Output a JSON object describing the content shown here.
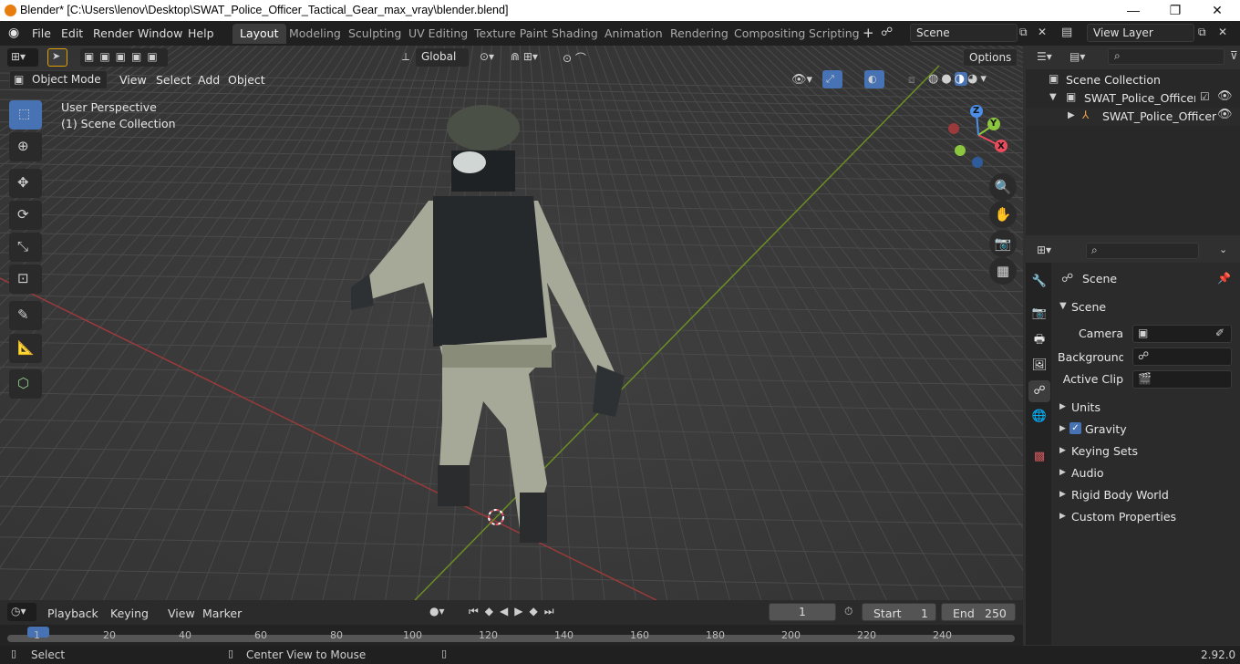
{
  "window": {
    "title": "Blender* [C:\\Users\\lenov\\Desktop\\SWAT_Police_Officer_Tactical_Gear_max_vray\\blender.blend]",
    "minimize": "—",
    "maximize": "❐",
    "close": "✕"
  },
  "menus": [
    "File",
    "Edit",
    "Render",
    "Window",
    "Help"
  ],
  "workspaces": [
    "Layout",
    "Modeling",
    "Sculpting",
    "UV Editing",
    "Texture Paint",
    "Shading",
    "Animation",
    "Rendering",
    "Compositing",
    "Scripting"
  ],
  "add_workspace": "+",
  "scene_field": "Scene",
  "view_layer_field": "View Layer",
  "header": {
    "transform_orientation": "Global",
    "options": "Options"
  },
  "viewport": {
    "mode": "Object Mode",
    "menus": [
      "View",
      "Select",
      "Add",
      "Object"
    ],
    "overlay_title": "User Perspective",
    "overlay_collection": "(1) Scene Collection",
    "gizmo": {
      "x": "X",
      "y": "Y",
      "z": "Z"
    }
  },
  "outliner": {
    "root": "Scene Collection",
    "collection": "SWAT_Police_Officer_Tac",
    "object": "SWAT_Police_Officer"
  },
  "properties": {
    "context": "Scene",
    "section": "Scene",
    "fields": [
      {
        "label": "Camera",
        "value": ""
      },
      {
        "label": "Background ...",
        "value": ""
      },
      {
        "label": "Active Clip",
        "value": ""
      }
    ],
    "panels": [
      "Units",
      "Gravity",
      "Keying Sets",
      "Audio",
      "Rigid Body World",
      "Custom Properties"
    ],
    "gravity_checked": true
  },
  "timeline": {
    "menus": [
      "Playback",
      "Keying",
      "View",
      "Marker"
    ],
    "current_frame": "1",
    "start_label": "Start",
    "start": "1",
    "end_label": "End",
    "end": "250",
    "ticks": [
      "1",
      "20",
      "40",
      "60",
      "80",
      "100",
      "120",
      "140",
      "160",
      "180",
      "200",
      "220",
      "240"
    ]
  },
  "status": {
    "left": "Select",
    "middle": "Center View to Mouse",
    "version": "2.92.0"
  },
  "colors": {
    "accent": "#4772b3",
    "axis_x": "#e84c5c",
    "axis_y": "#8cc63f",
    "axis_z": "#4c8fe8"
  }
}
